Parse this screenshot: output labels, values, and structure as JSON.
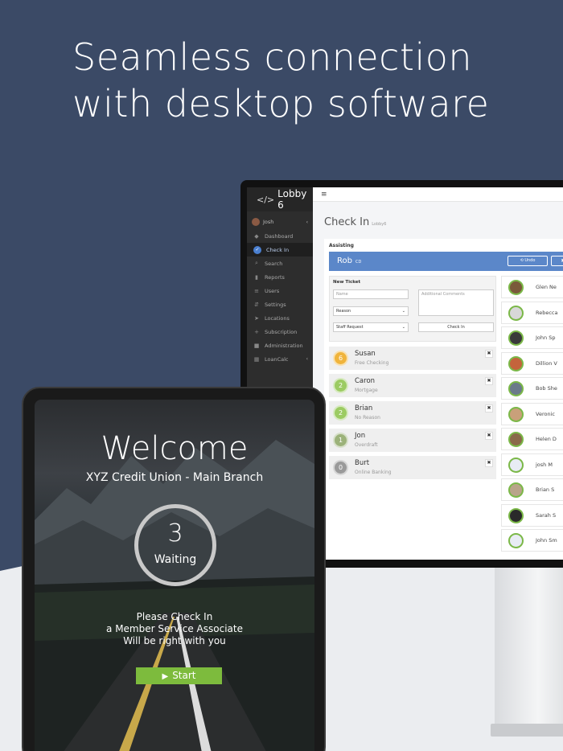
{
  "headline": {
    "line1": "Seamless connection",
    "line2": "with desktop software"
  },
  "colors": {
    "navy": "#3b4a66",
    "light": "#ebedf0",
    "assist_blue": "#5b87c9",
    "start_green": "#7dbb3d",
    "staff_ring": "#7bb848"
  },
  "desktop": {
    "app_name": "Lobby 6",
    "menu_icon": "≡",
    "user": "Josh",
    "nav": [
      {
        "label": "Dashboard",
        "icon": "dashboard-icon"
      },
      {
        "label": "Check In",
        "icon": "check-icon",
        "active": true
      },
      {
        "label": "Search",
        "icon": "search-icon"
      },
      {
        "label": "Reports",
        "icon": "chart-icon"
      },
      {
        "label": "Users",
        "icon": "list-icon"
      },
      {
        "label": "Settings",
        "icon": "sliders-icon"
      },
      {
        "label": "Locations",
        "icon": "location-icon"
      },
      {
        "label": "Subscription",
        "icon": "plus-icon"
      },
      {
        "label": "Administration",
        "icon": "lock-icon"
      },
      {
        "label": "LoanCalc",
        "icon": "calculator-icon"
      }
    ],
    "page_title": "Check In",
    "page_subtitle": "Lobby6",
    "assisting_label": "Assisting",
    "assisting_name": "Rob",
    "assisting_reason": "CD",
    "undo_label": "⟲ Undo",
    "close_label": "✖",
    "new_ticket": {
      "label": "New Ticket",
      "name_placeholder": "Name",
      "comments_placeholder": "Additional Comments",
      "reason_value": "Reason",
      "staff_value": "Staff Request",
      "checkin_label": "Check In"
    },
    "queue": [
      {
        "num": "6",
        "name": "Susan",
        "reason": "Free Checking",
        "color": "#f0b43c"
      },
      {
        "num": "2",
        "name": "Caron",
        "reason": "Mortgage",
        "color": "#9ccb62"
      },
      {
        "num": "2",
        "name": "Brian",
        "reason": "No Reason",
        "color": "#9ccb62"
      },
      {
        "num": "1",
        "name": "Jon",
        "reason": "Overdraft",
        "color": "#9cb27a"
      },
      {
        "num": "0",
        "name": "Burt",
        "reason": "Online Banking",
        "color": "#9a9a9a"
      }
    ],
    "queue_close": "✖",
    "staff": [
      {
        "name": "Glen Ne",
        "avatar": "#7a5a3a"
      },
      {
        "name": "Rebecca",
        "avatar": "#d8d8d8"
      },
      {
        "name": "John Sp",
        "avatar": "#3a3a3a"
      },
      {
        "name": "Dillion V",
        "avatar": "#c4643c"
      },
      {
        "name": "Bob She",
        "avatar": "#6b7a8a"
      },
      {
        "name": "Veronic",
        "avatar": "#c9a07a"
      },
      {
        "name": "Helen D",
        "avatar": "#8a6a4a"
      },
      {
        "name": "josh M",
        "avatar": "#e8ecf4"
      },
      {
        "name": "Brian S",
        "avatar": "#b9a48a"
      },
      {
        "name": "Sarah S",
        "avatar": "#2a2a2a"
      },
      {
        "name": "John Sm",
        "avatar": "#e8ecf4"
      }
    ]
  },
  "tablet": {
    "welcome": "Welcome",
    "branch": "XYZ Credit Union - Main Branch",
    "waiting_count": "3",
    "waiting_label": "Waiting",
    "msg_line1": "Please Check In",
    "msg_line2": "a Member Service Associate",
    "msg_line3": "Will be right with you",
    "start_label": "Start",
    "play_glyph": "▶"
  }
}
